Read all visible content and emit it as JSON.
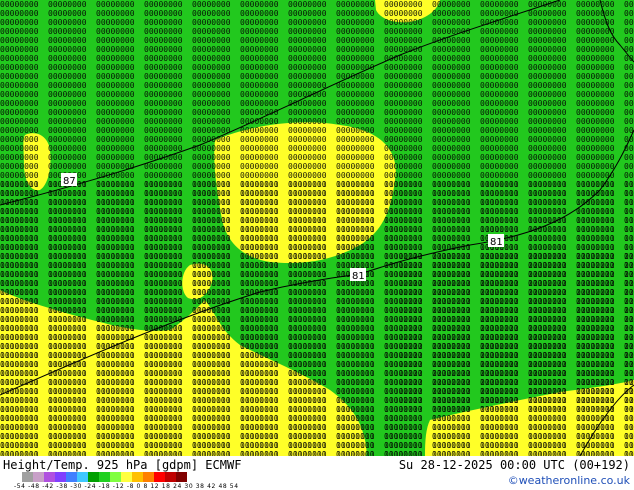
{
  "map": {
    "contour_labels": [
      "87",
      "81",
      "81"
    ]
  },
  "footer": {
    "title": "Height/Temp. 925 hPa [gdpm] ECMWF",
    "datetime": "Su 28-12-2025 00:00 UTC (00+192)",
    "credit": "©weatheronline.co.uk",
    "legend_ticks": "-54 -48 -42 -38 -30 -24 -18 -12 -8 0 8 12 18 24 30 38 42 48 54",
    "legend_colors": [
      "#a0a0a0",
      "#c8a0c8",
      "#b050e0",
      "#8040ff",
      "#4080ff",
      "#40c8ff",
      "#00a000",
      "#20d020",
      "#80ff40",
      "#ffff40",
      "#ffc000",
      "#ff8000",
      "#ff0000",
      "#c00000",
      "#800000"
    ]
  },
  "colors": {
    "green": "#22c81e",
    "yellow": "#ffff28",
    "light_yellow": "#f5f05a"
  }
}
